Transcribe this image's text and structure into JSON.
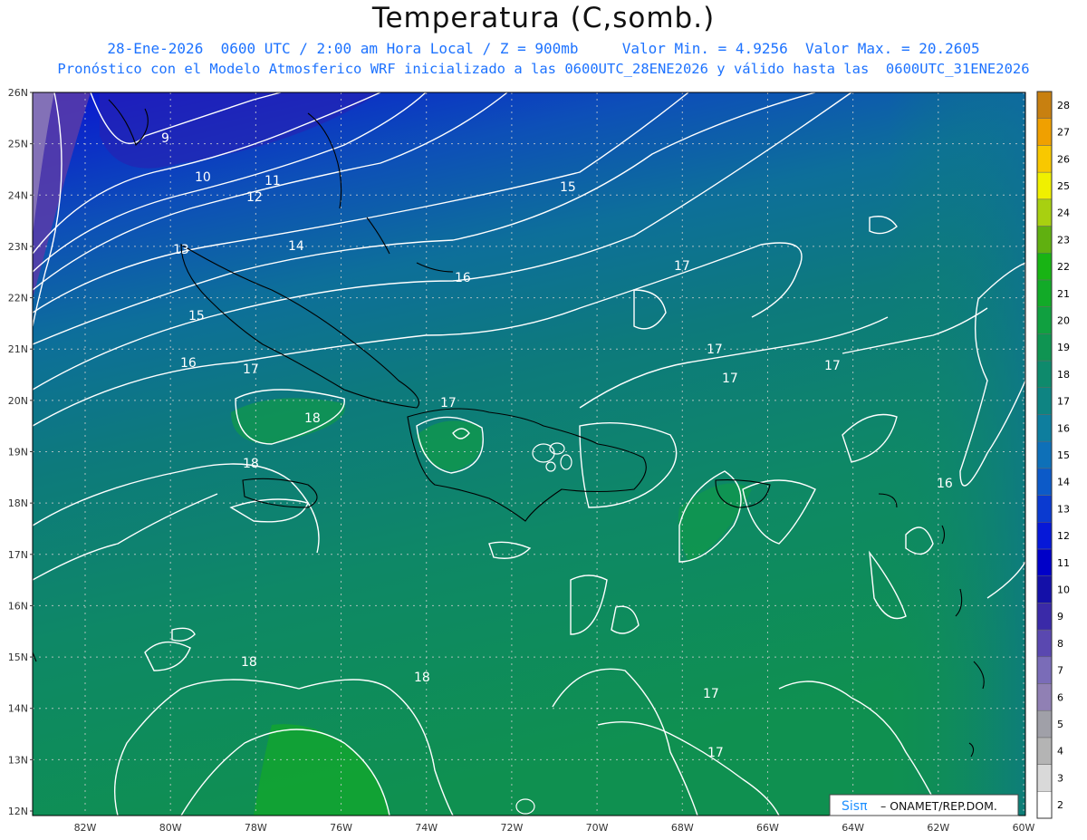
{
  "header": {
    "title": "Temperatura (C,somb.)",
    "subtitle_1": "28-Ene-2026  0600 UTC / 2:00 am Hora Local / Z = 900mb     Valor Min. = 4.9256  Valor Max. = 20.2605",
    "subtitle_2": "Pronóstico con el Modelo Atmosferico WRF inicializado a las 0600UTC_28ENE2026 y válido hasta las  0600UTC_31ENE2026"
  },
  "map": {
    "lat_labels": [
      "26N",
      "25N",
      "24N",
      "23N",
      "22N",
      "21N",
      "20N",
      "19N",
      "18N",
      "17N",
      "16N",
      "15N",
      "14N",
      "13N",
      "12N"
    ],
    "lon_labels": [
      "82W",
      "80W",
      "78W",
      "76W",
      "74W",
      "72W",
      "70W",
      "68W",
      "66W",
      "64W",
      "62W",
      "60W"
    ],
    "contour_labels": [
      "9",
      "10",
      "11",
      "12",
      "13",
      "14",
      "15",
      "15",
      "16",
      "16",
      "17",
      "17",
      "17",
      "17",
      "17",
      "17",
      "18",
      "18",
      "18",
      "18",
      "17",
      "17",
      "16"
    ],
    "colors": {
      "cold": "#0a14d2",
      "mid": "#0d5fb5",
      "teal": "#0c7a78",
      "warm": "#0d8c55",
      "hot": "#14a532",
      "contour": "#ffffff",
      "coast": "#000000",
      "grid": "#d0d0d0"
    }
  },
  "colorbar": {
    "values": [
      "2",
      "3",
      "4",
      "5",
      "6",
      "7",
      "8",
      "9",
      "10",
      "11",
      "12",
      "13",
      "14",
      "15",
      "16",
      "17",
      "18",
      "19",
      "20",
      "21",
      "22",
      "23",
      "24",
      "25",
      "26",
      "27",
      "28"
    ],
    "colors": [
      "#ffffff",
      "#d9d9d9",
      "#b4b4b4",
      "#a0a0a8",
      "#9080b4",
      "#7a6cb8",
      "#5a48b0",
      "#3a2aa8",
      "#1410a8",
      "#0000c8",
      "#0618d8",
      "#0a3ad0",
      "#0c5ac8",
      "#0e70b8",
      "#0e7e9e",
      "#0e8482",
      "#0e8a6c",
      "#0f9452",
      "#10a040",
      "#12aa28",
      "#18b414",
      "#60b010",
      "#a8d010",
      "#f0f000",
      "#f8c800",
      "#f0a000",
      "#c88010"
    ]
  },
  "credit": {
    "brand": "Sisπ",
    "text": "– ONAMET/REP.DOM."
  }
}
